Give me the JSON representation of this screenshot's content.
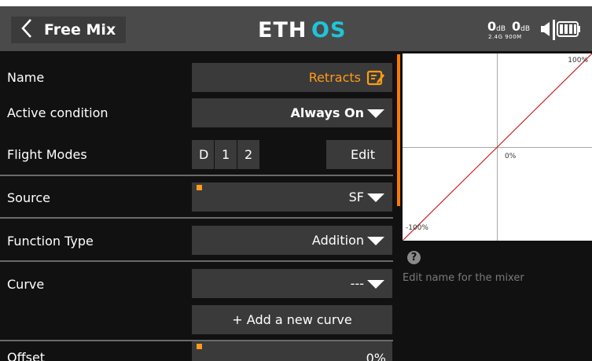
{
  "header": {
    "back_label": "Free Mix",
    "logo_text": "ETHOS",
    "rssi_a_value": "0",
    "rssi_a_unit": "dB",
    "rssi_b_value": "0",
    "rssi_b_unit": "dB",
    "rf_info": "2.4G 900M"
  },
  "form": {
    "name": {
      "label": "Name",
      "value": "Retracts"
    },
    "active_condition": {
      "label": "Active condition",
      "value": "Always On"
    },
    "flight_modes": {
      "label": "Flight Modes",
      "modes": [
        "D",
        "1",
        "2"
      ],
      "edit_label": "Edit"
    },
    "source": {
      "label": "Source",
      "value": "SF"
    },
    "function_type": {
      "label": "Function Type",
      "value": "Addition"
    },
    "curve": {
      "label": "Curve",
      "value": "---",
      "add_label": "+ Add a new curve"
    },
    "offset": {
      "label": "Offset",
      "value": "0%"
    }
  },
  "graph": {
    "label_max": "100%",
    "label_center": "0%",
    "label_min": "-100%",
    "line_color": "#cc2222"
  },
  "help": {
    "icon": "question-icon",
    "text": "Edit name for the mixer"
  },
  "colors": {
    "accent": "#ff9b16",
    "scroll": "#ff7a00",
    "field_bg": "#3a3a3a",
    "header_bg": "#4a4a4a"
  }
}
